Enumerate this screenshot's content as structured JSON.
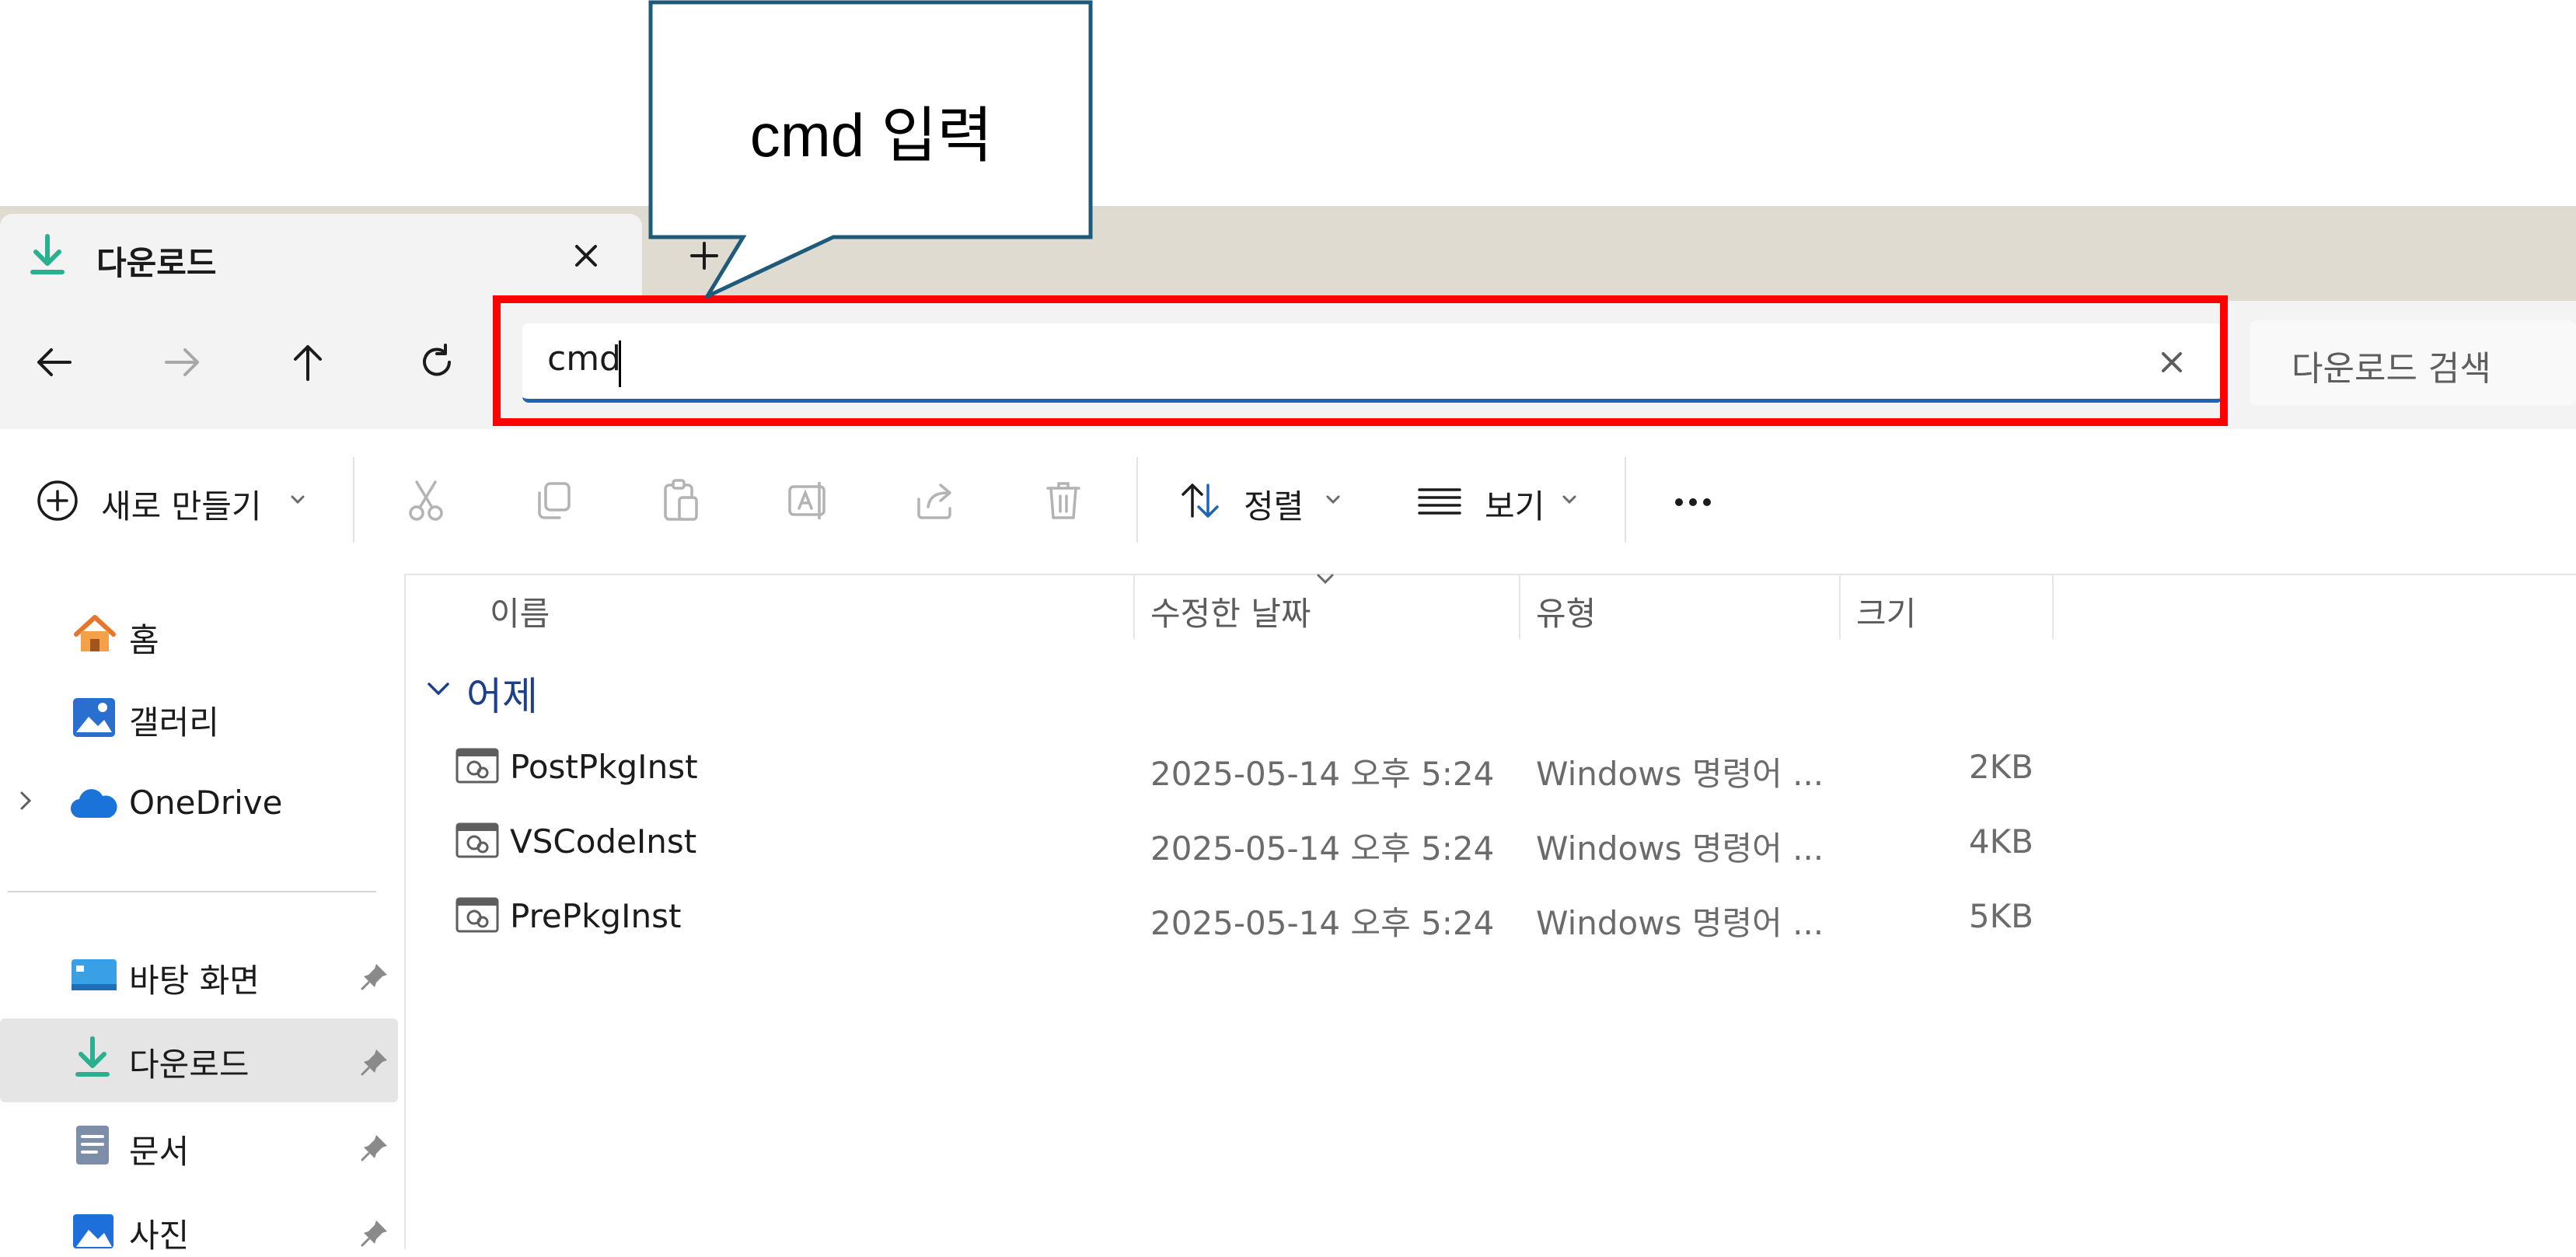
{
  "callout": {
    "text": "cmd 입력"
  },
  "tab": {
    "title": "다운로드",
    "close": "✕",
    "new": "+"
  },
  "address": {
    "value": "cmd",
    "clear": "✕"
  },
  "search": {
    "placeholder": "다운로드 검색"
  },
  "toolbar": {
    "new_label": "새로 만들기",
    "sort_label": "정렬",
    "view_label": "보기",
    "more": "···"
  },
  "sidebar": {
    "items": [
      {
        "label": "홈"
      },
      {
        "label": "갤러리"
      },
      {
        "label": "OneDrive"
      },
      {
        "label": "바탕 화면"
      },
      {
        "label": "다운로드"
      },
      {
        "label": "문서"
      },
      {
        "label": "사진"
      }
    ]
  },
  "columns": {
    "name": "이름",
    "modified": "수정한 날짜",
    "type": "유형",
    "size": "크기"
  },
  "group": {
    "label": "어제"
  },
  "files": [
    {
      "name": "PostPkgInst",
      "modified": "2025-05-14 오후 5:24",
      "type": "Windows 명령어 ...",
      "size": "2KB"
    },
    {
      "name": "VSCodeInst",
      "modified": "2025-05-14 오후 5:24",
      "type": "Windows 명령어 ...",
      "size": "4KB"
    },
    {
      "name": "PrePkgInst",
      "modified": "2025-05-14 오후 5:24",
      "type": "Windows 명령어 ...",
      "size": "5KB"
    }
  ],
  "colors": {
    "accent": "#1f63b5",
    "highlight": "#ff0000",
    "download": "#2bb08f",
    "callout_border": "#1e5a7a"
  }
}
